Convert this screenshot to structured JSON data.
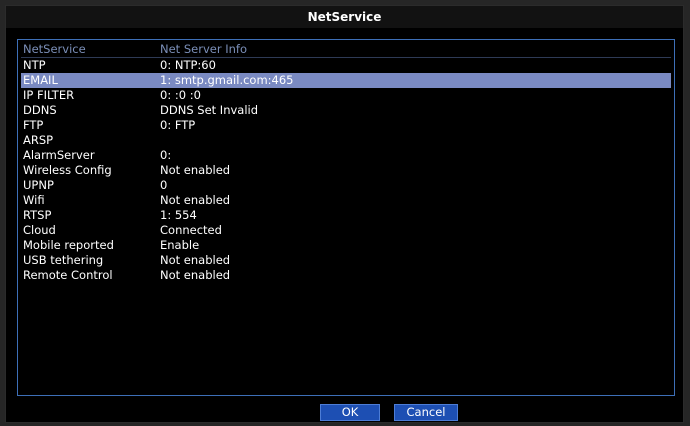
{
  "window": {
    "title": "NetService"
  },
  "list": {
    "header": {
      "name": "NetService",
      "info": "Net Server Info"
    },
    "rows": [
      {
        "name": "NTP",
        "info": "0: NTP:60"
      },
      {
        "name": "EMAIL",
        "info": "1: smtp.gmail.com:465",
        "selected": true
      },
      {
        "name": "IP FILTER",
        "info": "0: :0 :0"
      },
      {
        "name": "DDNS",
        "info": "DDNS Set Invalid"
      },
      {
        "name": "FTP",
        "info": "0: FTP"
      },
      {
        "name": "ARSP",
        "info": ""
      },
      {
        "name": "AlarmServer",
        "info": "0:"
      },
      {
        "name": "Wireless Config",
        "info": "Not enabled"
      },
      {
        "name": "UPNP",
        "info": "0"
      },
      {
        "name": "Wifi",
        "info": "Not enabled"
      },
      {
        "name": "RTSP",
        "info": "1: 554"
      },
      {
        "name": "Cloud",
        "info": "Connected"
      },
      {
        "name": "Mobile reported",
        "info": "Enable"
      },
      {
        "name": "USB tethering",
        "info": "Not enabled"
      },
      {
        "name": "Remote Control",
        "info": "Not enabled"
      }
    ]
  },
  "buttons": {
    "ok_label": "OK",
    "cancel_label": "Cancel"
  },
  "colors": {
    "selected_row": "#7a8ac2",
    "button": "#1d4fb3",
    "panel_border": "#3d6fb8"
  }
}
